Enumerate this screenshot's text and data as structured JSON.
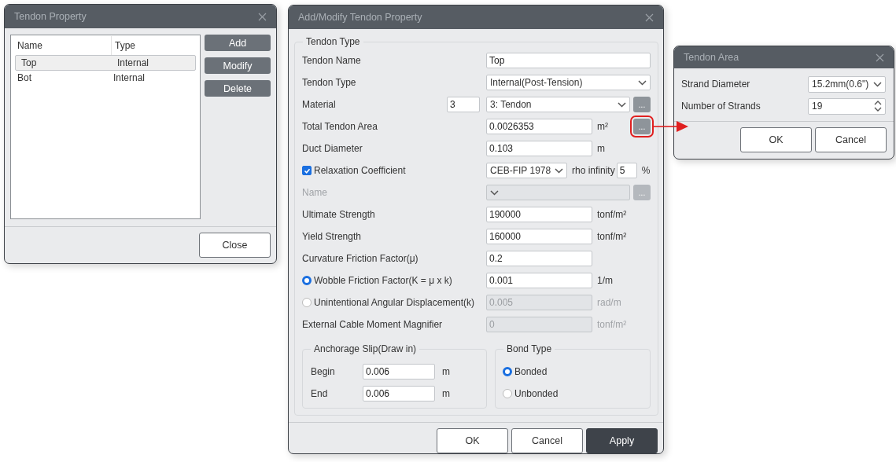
{
  "tendon_property": {
    "title": "Tendon Property",
    "columns": [
      "Name",
      "Type"
    ],
    "rows": [
      {
        "name": "Top",
        "type": "Internal",
        "selected": true
      },
      {
        "name": "Bot",
        "type": "Internal",
        "selected": false
      }
    ],
    "buttons": [
      "Add",
      "Modify",
      "Delete"
    ],
    "close": "Close"
  },
  "add_modify": {
    "title": "Add/Modify Tendon Property",
    "group_title": "Tendon Type",
    "fields": [
      {
        "kind": "wide_text",
        "label": "Tendon Name",
        "value": "Top"
      },
      {
        "kind": "select",
        "label": "Tendon Type",
        "value": "Internal(Post-Tension)"
      },
      {
        "kind": "select",
        "label": "Material",
        "number": "3",
        "value": "3: Tendon",
        "button": "..."
      },
      {
        "kind": "text",
        "label": "Total Tendon Area",
        "value": "0.0026353",
        "unit": "m²",
        "button": "...",
        "highlighted": true
      },
      {
        "kind": "text",
        "label": "Duct Diameter",
        "value": "0.103",
        "unit": "m"
      },
      {
        "kind": "checkbox",
        "label": "Relaxation Coefficient",
        "checked": true,
        "value": "CEB-FIP 1978",
        "extra_label": "rho infinity",
        "extra_value": "5",
        "unit": "%"
      },
      {
        "kind": "select",
        "label": "Name",
        "disabled": true,
        "button": "..."
      },
      {
        "kind": "text",
        "label": "Ultimate Strength",
        "value": "190000",
        "unit": "tonf/m²"
      },
      {
        "kind": "text",
        "label": "Yield Strength",
        "value": "160000",
        "unit": "tonf/m²"
      },
      {
        "kind": "text",
        "label": "Curvature Friction Factor(μ)",
        "value": "0.2"
      },
      {
        "kind": "radio",
        "label": "Wobble Friction Factor(K = μ x k)",
        "selected": true,
        "value": "0.001",
        "unit": "1/m"
      },
      {
        "kind": "radio",
        "label": "Unintentional Angular Displacement(k)",
        "selected": false,
        "value": "0.005",
        "unit": "rad/m",
        "disabled": true
      },
      {
        "kind": "text",
        "label": "External Cable Moment Magnifier",
        "value": "0",
        "unit": "tonf/m²",
        "disabled": true
      }
    ],
    "anchorage": {
      "title": "Anchorage Slip(Draw in)",
      "rows": [
        {
          "label": "Begin",
          "value": "0.006",
          "unit": "m"
        },
        {
          "label": "End",
          "value": "0.006",
          "unit": "m"
        }
      ]
    },
    "bond": {
      "title": "Bond Type",
      "options": [
        {
          "label": "Bonded",
          "selected": true
        },
        {
          "label": "Unbonded",
          "selected": false
        }
      ]
    },
    "buttons": [
      {
        "label": "OK",
        "primary": false
      },
      {
        "label": "Cancel",
        "primary": false
      },
      {
        "label": "Apply",
        "primary": true
      }
    ]
  },
  "tendon_area": {
    "title": "Tendon Area",
    "fields": [
      {
        "kind": "select",
        "label": "Strand Diameter",
        "value": "15.2mm(0.6\")"
      },
      {
        "kind": "spinner",
        "label": "Number of Strands",
        "value": "19"
      }
    ],
    "buttons": [
      "OK",
      "Cancel"
    ]
  }
}
